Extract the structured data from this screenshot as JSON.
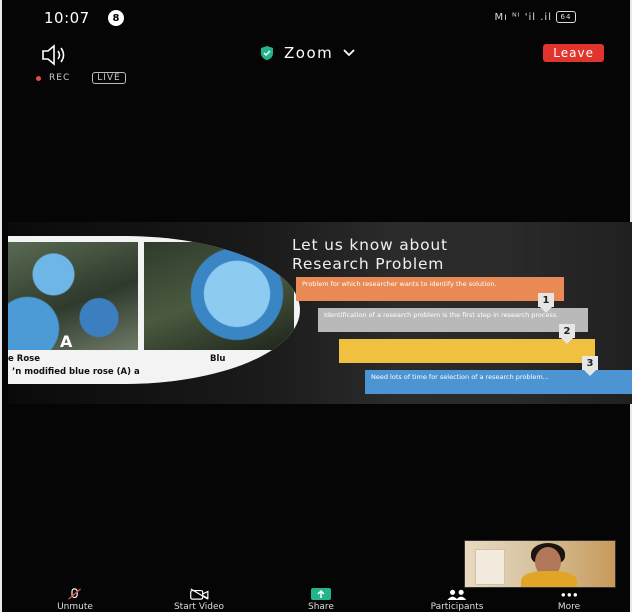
{
  "status_bar": {
    "time": "10:07",
    "notification_count": "8",
    "signal_text": "Mı ᴺᴵ 'il .il",
    "battery_text": "64"
  },
  "top_bar": {
    "title": "Zoom",
    "leave_label": "Leave"
  },
  "indicators": {
    "rec_label": "REC",
    "live_label": "LIVE"
  },
  "slide": {
    "heading_line1": "Let us know about",
    "heading_line2": "Research Problem",
    "photo_letter": "A",
    "photo_label_left": "ue Rose",
    "photo_label_right": "Blu",
    "photo_caption": "’n modified blue rose (A) a",
    "steps": [
      {
        "number": "1",
        "text": "Problem for which researcher wants to identify the solution."
      },
      {
        "number": "2",
        "text": "Identification of a research problem is the first step in research process."
      },
      {
        "number": "3",
        "text": ""
      },
      {
        "number": "",
        "text": "Need lots of time for selection of a research problem..."
      }
    ]
  },
  "toolbar": {
    "items": [
      {
        "label": "Unmute",
        "icon": "microphone-muted-icon"
      },
      {
        "label": "Start Video",
        "icon": "video-off-icon"
      },
      {
        "label": "Share",
        "icon": "share-screen-icon"
      },
      {
        "label": "Participants",
        "icon": "participants-icon"
      },
      {
        "label": "More",
        "icon": "more-icon"
      }
    ]
  },
  "colors": {
    "leave": "#e0342c",
    "share": "#23b48c",
    "rec": "#e24b40",
    "bar_orange": "#e98a55",
    "bar_grey": "#b9b9b9",
    "bar_yellow": "#f0c040",
    "bar_blue": "#4d94d2"
  }
}
